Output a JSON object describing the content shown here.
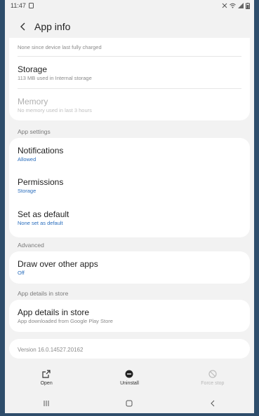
{
  "status_bar": {
    "time": "11:47",
    "icons": [
      "alarm-icon",
      "wifi-icon",
      "signal-icon",
      "battery-icon"
    ]
  },
  "app_bar": {
    "title": "App info"
  },
  "battery_row": {
    "subtitle": "None since device last fully charged"
  },
  "storage_row": {
    "title": "Storage",
    "subtitle": "113 MB used in Internal storage"
  },
  "memory_row": {
    "title": "Memory",
    "subtitle": "No memory used in last 3 hours"
  },
  "app_settings": {
    "header": "App settings",
    "notifications": {
      "title": "Notifications",
      "subtitle": "Allowed"
    },
    "permissions": {
      "title": "Permissions",
      "subtitle": "Storage"
    },
    "set_default": {
      "title": "Set as default",
      "subtitle": "None set as default"
    }
  },
  "advanced": {
    "header": "Advanced",
    "draw_over": {
      "title": "Draw over other apps",
      "subtitle": "Off"
    }
  },
  "store": {
    "header": "App details in store",
    "details": {
      "title": "App details in store",
      "subtitle": "App downloaded from Google Play Store"
    }
  },
  "version": {
    "text": "Version 16.0.14527.20162"
  },
  "bottom_actions": {
    "open": "Open",
    "uninstall": "Uninstall",
    "force_stop": "Force stop"
  },
  "colors": {
    "accent_blue": "#2a6ebd",
    "background": "#f2f2f2",
    "card": "#ffffff",
    "frame": "#2e4d6b"
  }
}
